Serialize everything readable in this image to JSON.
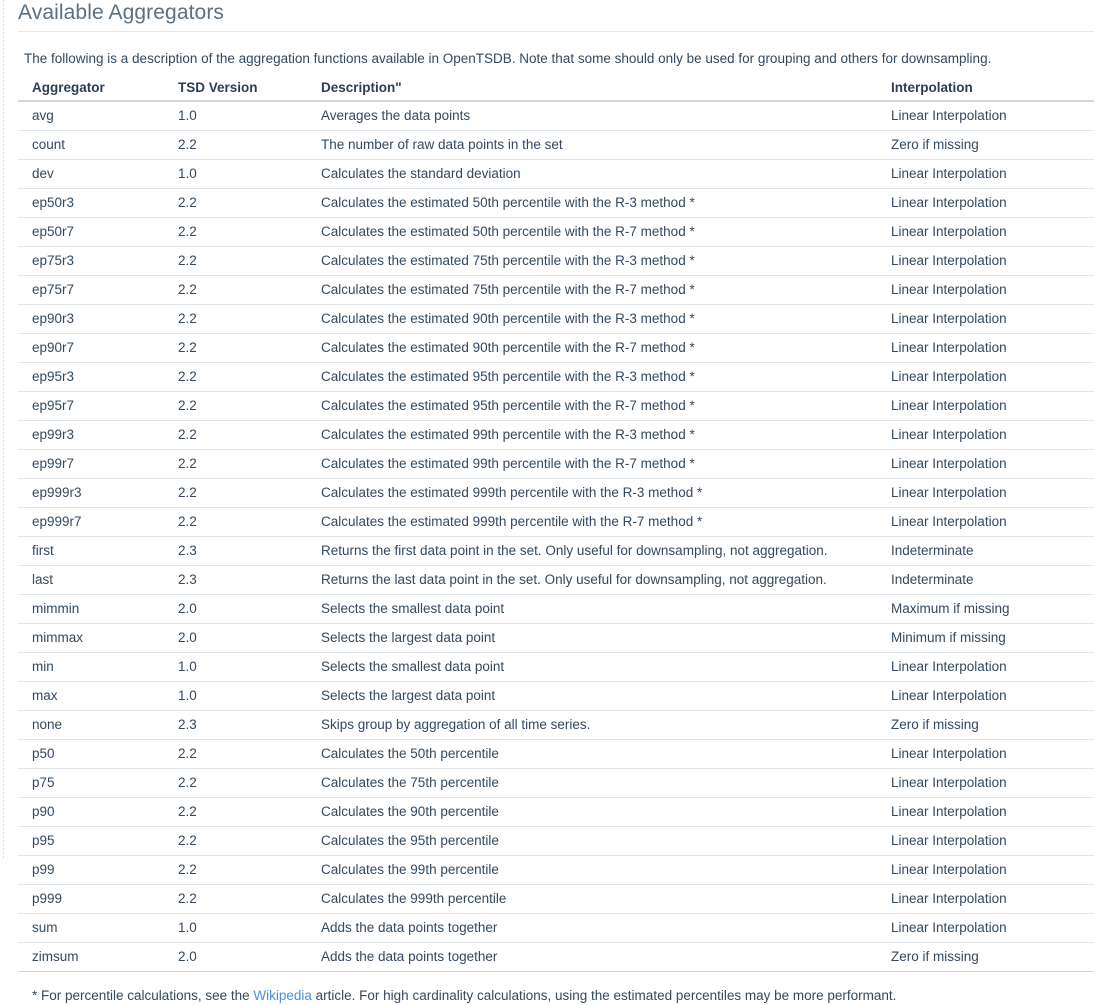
{
  "page": {
    "title": "Available Aggregators",
    "intro": "The following is a description of the aggregation functions available in OpenTSDB. Note that some should only be used for grouping and others for downsampling.",
    "footnote_prefix": "* For percentile calculations, see the ",
    "footnote_link": "Wikipedia",
    "footnote_suffix": " article. For high cardinality calculations, using the estimated percentiles may be more performant."
  },
  "colors": {
    "title": "#5c7080",
    "body_text": "#34495e",
    "header_text": "#2c3e50",
    "link": "#4a90d9",
    "row_border": "#e3e6e8",
    "header_border": "#cfd6dc",
    "background": "#ffffff"
  },
  "table": {
    "columns": [
      {
        "key": "aggregator",
        "label": "Aggregator"
      },
      {
        "key": "version",
        "label": "TSD Version"
      },
      {
        "key": "description",
        "label": "Description\""
      },
      {
        "key": "interpolation",
        "label": "Interpolation"
      }
    ],
    "rows": [
      {
        "aggregator": "avg",
        "version": "1.0",
        "description": "Averages the data points",
        "interpolation": "Linear Interpolation"
      },
      {
        "aggregator": "count",
        "version": "2.2",
        "description": "The number of raw data points in the set",
        "interpolation": "Zero if missing"
      },
      {
        "aggregator": "dev",
        "version": "1.0",
        "description": "Calculates the standard deviation",
        "interpolation": "Linear Interpolation"
      },
      {
        "aggregator": "ep50r3",
        "version": "2.2",
        "description": "Calculates the estimated 50th percentile with the R-3 method *",
        "interpolation": "Linear Interpolation"
      },
      {
        "aggregator": "ep50r7",
        "version": "2.2",
        "description": "Calculates the estimated 50th percentile with the R-7 method *",
        "interpolation": "Linear Interpolation"
      },
      {
        "aggregator": "ep75r3",
        "version": "2.2",
        "description": "Calculates the estimated 75th percentile with the R-3 method *",
        "interpolation": "Linear Interpolation"
      },
      {
        "aggregator": "ep75r7",
        "version": "2.2",
        "description": "Calculates the estimated 75th percentile with the R-7 method *",
        "interpolation": "Linear Interpolation"
      },
      {
        "aggregator": "ep90r3",
        "version": "2.2",
        "description": "Calculates the estimated 90th percentile with the R-3 method *",
        "interpolation": "Linear Interpolation"
      },
      {
        "aggregator": "ep90r7",
        "version": "2.2",
        "description": "Calculates the estimated 90th percentile with the R-7 method *",
        "interpolation": "Linear Interpolation"
      },
      {
        "aggregator": "ep95r3",
        "version": "2.2",
        "description": "Calculates the estimated 95th percentile with the R-3 method *",
        "interpolation": "Linear Interpolation"
      },
      {
        "aggregator": "ep95r7",
        "version": "2.2",
        "description": "Calculates the estimated 95th percentile with the R-7 method *",
        "interpolation": "Linear Interpolation"
      },
      {
        "aggregator": "ep99r3",
        "version": "2.2",
        "description": "Calculates the estimated 99th percentile with the R-3 method *",
        "interpolation": "Linear Interpolation"
      },
      {
        "aggregator": "ep99r7",
        "version": "2.2",
        "description": "Calculates the estimated 99th percentile with the R-7 method *",
        "interpolation": "Linear Interpolation"
      },
      {
        "aggregator": "ep999r3",
        "version": "2.2",
        "description": "Calculates the estimated 999th percentile with the R-3 method *",
        "interpolation": "Linear Interpolation"
      },
      {
        "aggregator": "ep999r7",
        "version": "2.2",
        "description": "Calculates the estimated 999th percentile with the R-7 method *",
        "interpolation": "Linear Interpolation"
      },
      {
        "aggregator": "first",
        "version": "2.3",
        "description": "Returns the first data point in the set. Only useful for downsampling, not aggregation.",
        "interpolation": "Indeterminate"
      },
      {
        "aggregator": "last",
        "version": "2.3",
        "description": "Returns the last data point in the set. Only useful for downsampling, not aggregation.",
        "interpolation": "Indeterminate"
      },
      {
        "aggregator": "mimmin",
        "version": "2.0",
        "description": "Selects the smallest data point",
        "interpolation": "Maximum if missing"
      },
      {
        "aggregator": "mimmax",
        "version": "2.0",
        "description": "Selects the largest data point",
        "interpolation": "Minimum if missing"
      },
      {
        "aggregator": "min",
        "version": "1.0",
        "description": "Selects the smallest data point",
        "interpolation": "Linear Interpolation"
      },
      {
        "aggregator": "max",
        "version": "1.0",
        "description": "Selects the largest data point",
        "interpolation": "Linear Interpolation"
      },
      {
        "aggregator": "none",
        "version": "2.3",
        "description": "Skips group by aggregation of all time series.",
        "interpolation": "Zero if missing"
      },
      {
        "aggregator": "p50",
        "version": "2.2",
        "description": "Calculates the 50th percentile",
        "interpolation": "Linear Interpolation"
      },
      {
        "aggregator": "p75",
        "version": "2.2",
        "description": "Calculates the 75th percentile",
        "interpolation": "Linear Interpolation"
      },
      {
        "aggregator": "p90",
        "version": "2.2",
        "description": "Calculates the 90th percentile",
        "interpolation": "Linear Interpolation"
      },
      {
        "aggregator": "p95",
        "version": "2.2",
        "description": "Calculates the 95th percentile",
        "interpolation": "Linear Interpolation"
      },
      {
        "aggregator": "p99",
        "version": "2.2",
        "description": "Calculates the 99th percentile",
        "interpolation": "Linear Interpolation"
      },
      {
        "aggregator": "p999",
        "version": "2.2",
        "description": "Calculates the 999th percentile",
        "interpolation": "Linear Interpolation"
      },
      {
        "aggregator": "sum",
        "version": "1.0",
        "description": "Adds the data points together",
        "interpolation": "Linear Interpolation"
      },
      {
        "aggregator": "zimsum",
        "version": "2.0",
        "description": "Adds the data points together",
        "interpolation": "Zero if missing"
      }
    ]
  }
}
